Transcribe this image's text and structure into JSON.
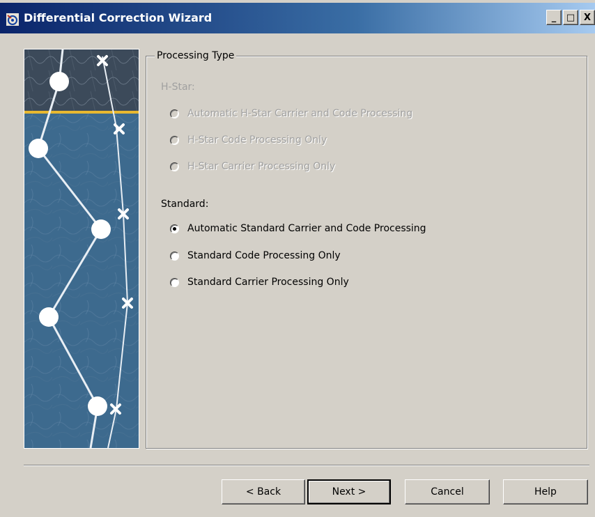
{
  "window": {
    "title": "Differential Correction Wizard",
    "buttons": {
      "minimize": "_",
      "maximize": "□",
      "close": "X"
    }
  },
  "group": {
    "legend": "Processing Type",
    "hstar": {
      "label": "H-Star:",
      "options": [
        {
          "label": "Automatic H-Star Carrier and Code Processing",
          "selected": false,
          "enabled": false
        },
        {
          "label": "H-Star Code Processing Only",
          "selected": false,
          "enabled": false
        },
        {
          "label": "H-Star Carrier Processing Only",
          "selected": false,
          "enabled": false
        }
      ]
    },
    "standard": {
      "label": "Standard:",
      "options": [
        {
          "label": "Automatic Standard Carrier and Code Processing",
          "selected": true,
          "enabled": true
        },
        {
          "label": "Standard Code Processing Only",
          "selected": false,
          "enabled": true
        },
        {
          "label": "Standard Carrier Processing Only",
          "selected": false,
          "enabled": true
        }
      ]
    }
  },
  "footer": {
    "back": "< Back",
    "next": "Next >",
    "cancel": "Cancel",
    "help": "Help"
  },
  "colors": {
    "titlebar_start": "#0a246a",
    "titlebar_end": "#a6caf0",
    "dialog_bg": "#d4d0c8",
    "disabled_text": "#a0a0a0",
    "accent_line": "#e8b830"
  },
  "icons": {
    "app": "satellite-app-icon"
  }
}
